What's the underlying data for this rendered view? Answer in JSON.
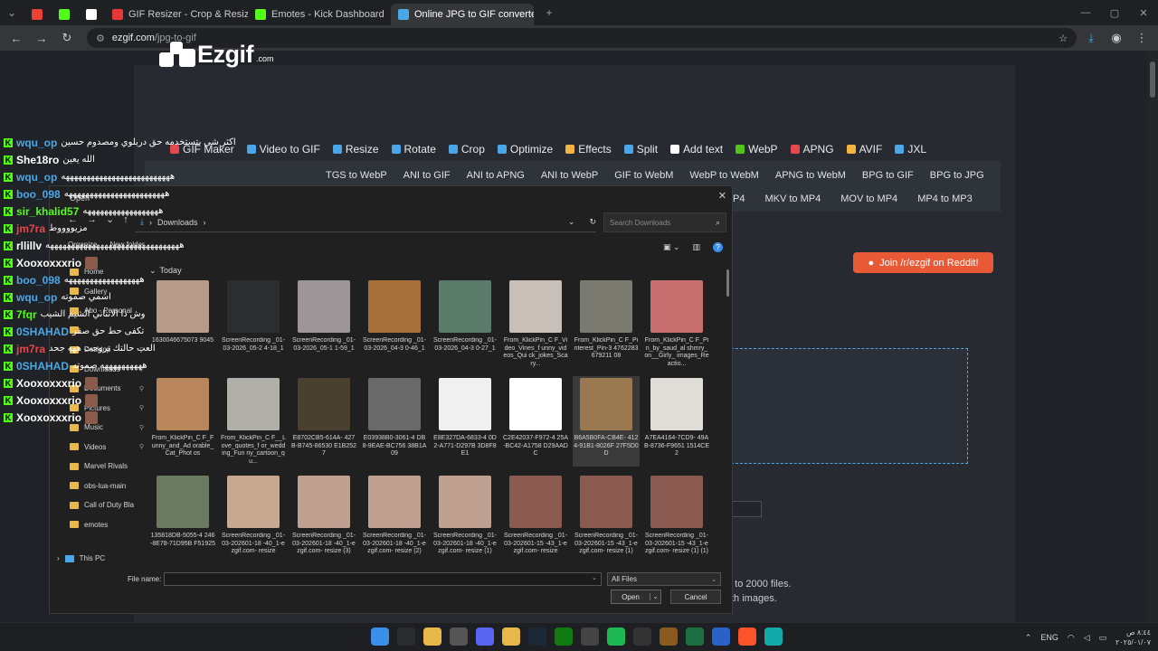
{
  "browser": {
    "tabs": [
      {
        "label": "",
        "color": "#ea4335",
        "pinned": true
      },
      {
        "label": "",
        "color": "#53fc18",
        "pinned": true
      },
      {
        "label": "",
        "color": "#ffffff",
        "pinned": true
      },
      {
        "label": "GIF Resizer - Crop & Resize Ani",
        "color": "#e53935",
        "pinned": false
      },
      {
        "label": "Emotes - Kick Dashboard",
        "color": "#53fc18",
        "pinned": false
      },
      {
        "label": "Online JPG to GIF converter",
        "color": "#4aa7e8",
        "pinned": false,
        "active": true
      }
    ],
    "url_host": "ezgif.com",
    "url_path": "/jpg-to-gif"
  },
  "site": {
    "logo_text": "Ezgif",
    "logo_suffix": ".com",
    "main_nav": [
      {
        "label": "GIF Maker",
        "color": "#e5484d"
      },
      {
        "label": "Video to GIF",
        "color": "#4aa7e8"
      },
      {
        "label": "Resize",
        "color": "#4aa7e8"
      },
      {
        "label": "Rotate",
        "color": "#4aa7e8"
      },
      {
        "label": "Crop",
        "color": "#4aa7e8"
      },
      {
        "label": "Optimize",
        "color": "#4aa7e8"
      },
      {
        "label": "Effects",
        "color": "#f5b342"
      },
      {
        "label": "Split",
        "color": "#4aa7e8"
      },
      {
        "label": "Add text",
        "color": "#ffffff"
      },
      {
        "label": "WebP",
        "color": "#53c41a"
      },
      {
        "label": "APNG",
        "color": "#e5484d"
      },
      {
        "label": "AVIF",
        "color": "#f5b342"
      },
      {
        "label": "JXL",
        "color": "#4aa7e8"
      }
    ],
    "sub_nav_row1": [
      "TGS to WebP",
      "ANI to GIF",
      "ANI to APNG",
      "ANI to WebP",
      "GIF to WebM",
      "WebP to WebM",
      "APNG to WebM",
      "BPG to GIF",
      "BPG to JPG"
    ],
    "sub_nav_row2": [
      "P4",
      "MKV to MP4",
      "MOV to MP4",
      "MP4 to MP3"
    ],
    "reddit_label": "Join /r/ezgif on Reddit!",
    "note1": "p to 2000 files.",
    "note2": "th images."
  },
  "chat": [
    {
      "user": "wqu_op",
      "color": "#4aa7e8",
      "text": "اكثر شي بتستخدمه حق دربلوي ومصدوم حسين"
    },
    {
      "user": "She18ro",
      "color": "#ffffff",
      "text": "الله يعين"
    },
    {
      "user": "wqu_op",
      "color": "#4aa7e8",
      "text": "ههههههههههههههههههههههههههه"
    },
    {
      "user": "boo_098",
      "color": "#4aa7e8",
      "text": "ههههههههههههههههههههههههه"
    },
    {
      "user": "sir_khalid57",
      "color": "#53fc18",
      "text": "ههههههههههههههههههه"
    },
    {
      "user": "jm7ra",
      "color": "#e5484d",
      "text": "مزيووووط"
    },
    {
      "user": "rllillv",
      "color": "#ffffff",
      "text": "ههههههههههههههههههههههههههههههههه"
    },
    {
      "user": "Xooxoxxxrio",
      "color": "#ffffff",
      "text": ""
    },
    {
      "user": "boo_098",
      "color": "#4aa7e8",
      "text": "ههههههههههههههههههه"
    },
    {
      "user": "wqu_op",
      "color": "#4aa7e8",
      "text": "اسمي صموته"
    },
    {
      "user": "7fqr",
      "color": "#53fc18",
      "text": "وش ذا الانتاني الشيم الشيب"
    },
    {
      "user": "0SHAHAD",
      "color": "#4aa7e8",
      "text": "تكفى حط حق صقر"
    },
    {
      "user": "jm7ra",
      "color": "#e5484d",
      "text": "العب حالتك تروحت ههه جحد"
    },
    {
      "user": "0SHAHAD",
      "color": "#4aa7e8",
      "text": "ههههههههههه صموته"
    },
    {
      "user": "Xooxoxxxrio",
      "color": "#ffffff",
      "text": ""
    },
    {
      "user": "Xooxoxxxrio",
      "color": "#ffffff",
      "text": ""
    },
    {
      "user": "Xooxoxxxrio",
      "color": "#ffffff",
      "text": ""
    }
  ],
  "dialog": {
    "title": "Open",
    "breadcrumb": "Downloads",
    "search_placeholder": "Search Downloads",
    "organize": "Organize",
    "new_folder": "New folder",
    "group_label": "Today",
    "nav_items": [
      {
        "label": "Home",
        "pin": false,
        "icon": "home-icon"
      },
      {
        "label": "Gallery",
        "pin": false,
        "icon": "gallery-icon"
      },
      {
        "label": "Abo - Personal",
        "pin": false,
        "icon": "cloud-icon"
      },
      {
        "label": "",
        "pin": false,
        "icon": "folder-icon"
      },
      {
        "label": "Desktop",
        "pin": true,
        "icon": "desktop-icon"
      },
      {
        "label": "Downloads",
        "pin": true,
        "icon": "download-icon"
      },
      {
        "label": "Documents",
        "pin": true,
        "icon": "document-icon"
      },
      {
        "label": "Pictures",
        "pin": true,
        "icon": "picture-icon"
      },
      {
        "label": "Music",
        "pin": true,
        "icon": "music-icon"
      },
      {
        "label": "Videos",
        "pin": true,
        "icon": "video-icon"
      },
      {
        "label": "Marvel Rivals",
        "pin": false,
        "icon": "folder-icon"
      },
      {
        "label": "obs-lua-main",
        "pin": false,
        "icon": "folder-icon"
      },
      {
        "label": "Call of Duty Bla",
        "pin": false,
        "icon": "folder-icon"
      },
      {
        "label": "emotes",
        "pin": false,
        "icon": "folder-icon"
      }
    ],
    "this_pc": "This PC",
    "files": [
      {
        "name": "1630046675073 9045",
        "color": "#b89a8a"
      },
      {
        "name": "ScreenRecording _01-03-2026_05-2 4-18_1",
        "color": "#2a2e30"
      },
      {
        "name": "ScreenRecording _01-03-2026_05-1 1-59_1",
        "color": "#9c9698"
      },
      {
        "name": "ScreenRecording _01-03-2026_04-3 0-46_1",
        "color": "#a8703a"
      },
      {
        "name": "ScreenRecording _01-03-2026_04-3 0-27_1",
        "color": "#5a7a6a"
      },
      {
        "name": "From_KlickPin_C F_Video_Vines_f unny_videos_Qui ck_jokes_Scary...",
        "color": "#c8c0b8"
      },
      {
        "name": "From_KlickPin_C F_Pinterest_Pin-3 4762283679211 08",
        "color": "#7a7a70"
      },
      {
        "name": "From_KlickPin_C F_Pin_by_saud_al shmry_on__Girly_ images_Reactio...",
        "color": "#c87070"
      },
      {
        "name": "From_KlickPin_C F_Funny_and_Ad orable_Cat_Phot os",
        "color": "#b8865a"
      },
      {
        "name": "From_KlickPin_C F__Love_quotes_f or_wedding_Fun ny_cartoon_qu...",
        "color": "#b0b0a8"
      },
      {
        "name": "E8702CB5-614A- 427B-B745-86530 E1B2527",
        "color": "#4a4030"
      },
      {
        "name": "E03938B0-3061-4 DB8-9EAE-BC756 38B1A09",
        "color": "#6a6a6a"
      },
      {
        "name": "E8E327DA-6833-4 0D2-A771-D297B 3D8F8E1",
        "color": "#f0f0f0"
      },
      {
        "name": "C2E42037-F972-4 25A-BC42-A1758 D29AADC",
        "color": "#ffffff"
      },
      {
        "name": "B6A5B0FA-CB4E- 4124-91B1-8026F 27F5D0D",
        "color": "#9a7850",
        "selected": true
      },
      {
        "name": "A7EA4164-7CD9- 49AB-8736-F9651 1514CE2",
        "color": "#e0dcd8"
      },
      {
        "name": "135818DB-5055-4 246-8E78-71D95B F51925",
        "color": "#6a7a60"
      },
      {
        "name": "ScreenRecording _01-03-202601-18 -40_1-ezgif.com- resize",
        "color": "#c8a890"
      },
      {
        "name": "ScreenRecording _01-03-202601-18 -40_1-ezgif.com- resize (3)",
        "color": "#c0a090"
      },
      {
        "name": "ScreenRecording _01-03-202601-18 -40_1-ezgif.com- resize (2)",
        "color": "#c0a090"
      },
      {
        "name": "ScreenRecording _01-03-202601-18 -40_1-ezgif.com- resize (1)",
        "color": "#c0a090"
      },
      {
        "name": "ScreenRecording _01-03-202601-15 -43_1-ezgif.com- resize",
        "color": "#8a5a50"
      },
      {
        "name": "ScreenRecording _01-03-202601-15 -43_1-ezgif.com- resize (1)",
        "color": "#8a5a50"
      },
      {
        "name": "ScreenRecording _01-03-202601-15 -43_1-ezgif.com- resize (1) (1)",
        "color": "#8a5a50"
      }
    ],
    "file_name_label": "File name:",
    "file_name_value": "",
    "filter_value": "All Files",
    "open_label": "Open",
    "cancel_label": "Cancel"
  },
  "taskbar": {
    "apps": [
      {
        "name": "start-icon",
        "color": "#3b8eea"
      },
      {
        "name": "search-icon",
        "color": "#2a2b2f"
      },
      {
        "name": "files-icon",
        "color": "#e8b84a"
      },
      {
        "name": "settings-icon",
        "color": "#555"
      },
      {
        "name": "discord-icon",
        "color": "#5865f2"
      },
      {
        "name": "chrome-icon",
        "color": "#e8b84a"
      },
      {
        "name": "steam-icon",
        "color": "#1b2838"
      },
      {
        "name": "xbox-icon",
        "color": "#107c10"
      },
      {
        "name": "app-icon",
        "color": "#444"
      },
      {
        "name": "spotify-icon",
        "color": "#1db954"
      },
      {
        "name": "ccleaner-icon",
        "color": "#333"
      },
      {
        "name": "archive-icon",
        "color": "#8a5a20"
      },
      {
        "name": "excel-icon",
        "color": "#1d6f42"
      },
      {
        "name": "mail-icon",
        "color": "#2a62c8"
      },
      {
        "name": "brave-icon",
        "color": "#fb542b"
      },
      {
        "name": "capcut-icon",
        "color": "#1aa"
      }
    ],
    "lang": "ENG",
    "time": "٨:٤٤ ص",
    "date": "٢٠٢٥/٠١/٠٧"
  }
}
